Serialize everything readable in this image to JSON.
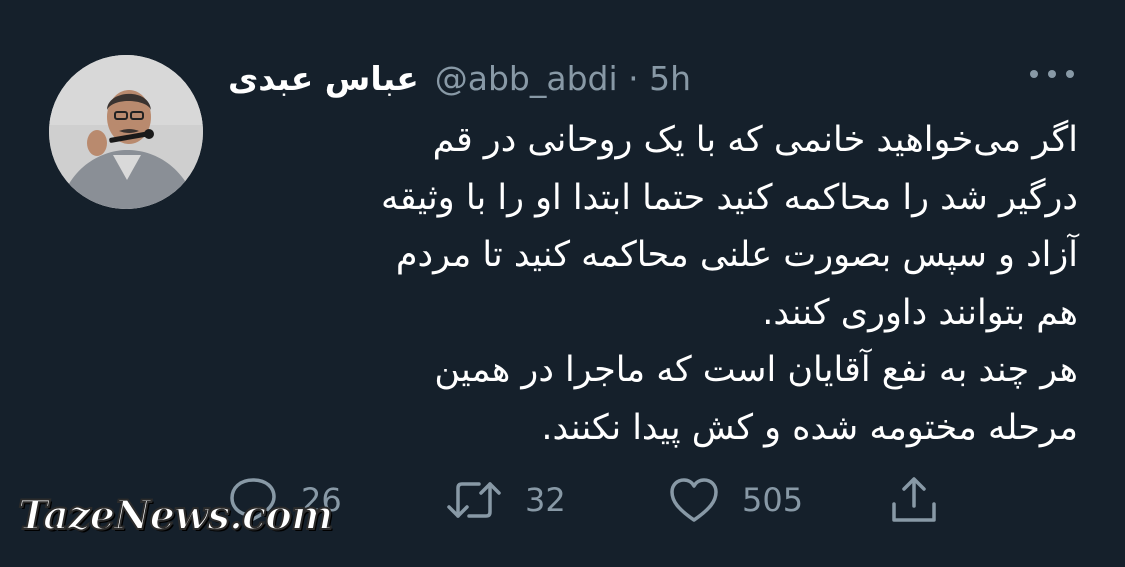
{
  "tweet": {
    "author": {
      "display_name": "عباس عبدی",
      "handle": "@abb_abdi",
      "time": "· 5h"
    },
    "text_lines": [
      "اگر می‌خواهید خانمی که با یک روحانی در قم",
      "درگیر شد را محاکمه کنید حتما ابتدا او را با وثیقه",
      "آزاد و سپس بصورت علنی محاکمه کنید تا مردم",
      "هم بتوانند داوری کنند.",
      "هر چند به نفع آقایان است که ماجرا در همین",
      "مرحله مختومه شده و کش پیدا نکنند."
    ],
    "actions": {
      "reply_count": "26",
      "retweet_count": "32",
      "like_count": "505"
    }
  },
  "watermark": "TazeNews.com",
  "colors": {
    "background": "#15202b",
    "text": "#ffffff",
    "secondary": "#8899a6"
  },
  "icons": {
    "reply": "reply-icon",
    "retweet": "retweet-icon",
    "like": "heart-icon",
    "share": "share-icon",
    "more": "more-icon"
  }
}
